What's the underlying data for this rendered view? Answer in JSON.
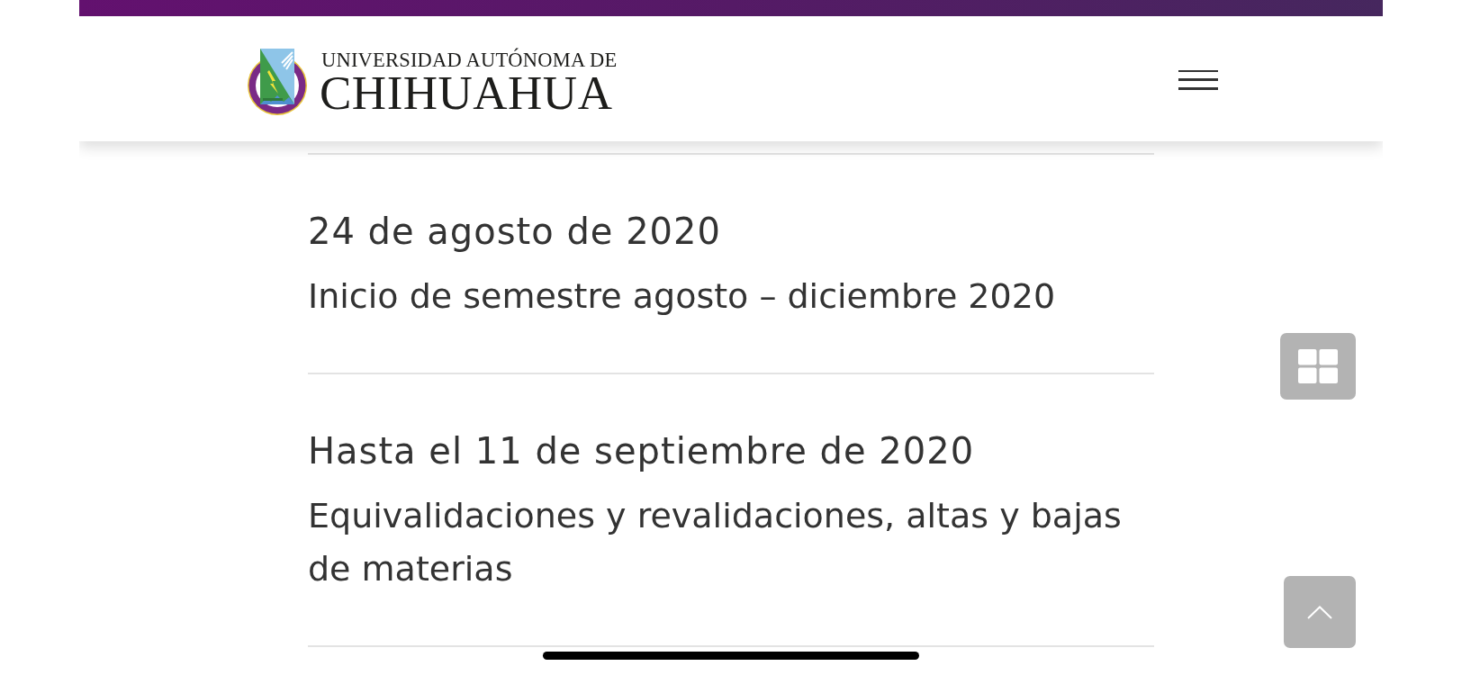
{
  "header": {
    "logo": {
      "line1": "UNIVERSIDAD AUTÓNOMA DE",
      "line2": "CHIHUAHUA"
    }
  },
  "events": [
    {
      "date": "24 de agosto de 2020",
      "description": "Inicio de semestre agosto – diciembre 2020"
    },
    {
      "date": "Hasta el 11 de septiembre de 2020",
      "description": "Equivalidaciones y revalidaciones, altas y bajas de materias"
    }
  ]
}
